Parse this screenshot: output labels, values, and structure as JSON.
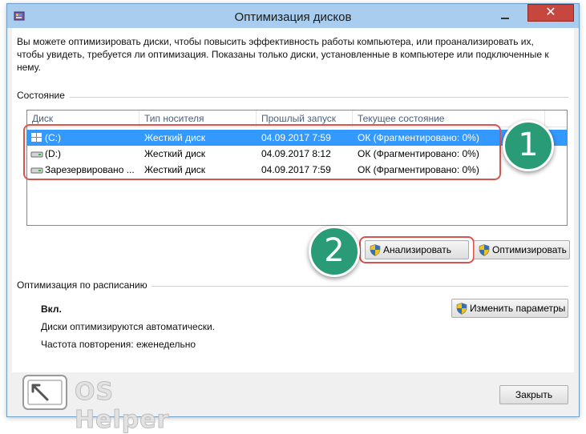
{
  "window": {
    "title": "Оптимизация дисков",
    "close_label": "✕"
  },
  "description": "Вы можете оптимизировать диски, чтобы повысить эффективность работы  компьютера, или проанализировать их, чтобы увидеть, требуется ли оптимизация. Показаны только диски, установленные в компьютере или подключенные к нему.",
  "status_section": {
    "label": "Состояние",
    "columns": [
      "Диск",
      "Тип носителя",
      "Прошлый запуск",
      "Текущее состояние"
    ],
    "rows": [
      {
        "drive": "(C:)",
        "media": "Жесткий диск",
        "last_run": "04.09.2017 7:59",
        "status": "ОК (Фрагментировано: 0%)",
        "icon": "windows-drive-icon",
        "selected": true
      },
      {
        "drive": "(D:)",
        "media": "Жесткий диск",
        "last_run": "04.09.2017 8:12",
        "status": "ОК (Фрагментировано: 0%)",
        "icon": "hard-drive-icon",
        "selected": false
      },
      {
        "drive": "Зарезервировано ...",
        "media": "Жесткий диск",
        "last_run": "04.09.2017 7:59",
        "status": "ОК (Фрагментировано: 0%)",
        "icon": "hard-drive-icon",
        "selected": false
      }
    ]
  },
  "actions": {
    "analyze_label": "Анализировать",
    "optimize_label": "Оптимизировать"
  },
  "schedule_section": {
    "label": "Оптимизация по расписанию",
    "state": "Вкл.",
    "auto_text": "Диски оптимизируются автоматически.",
    "frequency_text": "Частота повторения: еженедельно",
    "change_label": "Изменить параметры"
  },
  "footer": {
    "close_label": "Закрыть",
    "watermark_text": "OS Helper"
  },
  "annotations": {
    "marker_1": "1",
    "marker_2": "2",
    "accent_color": "#2a9b77",
    "ring_color": "#d9534f"
  },
  "colors": {
    "titlebar": "#a8cdee",
    "selection": "#3399ff",
    "close_button": "#c7463e"
  }
}
